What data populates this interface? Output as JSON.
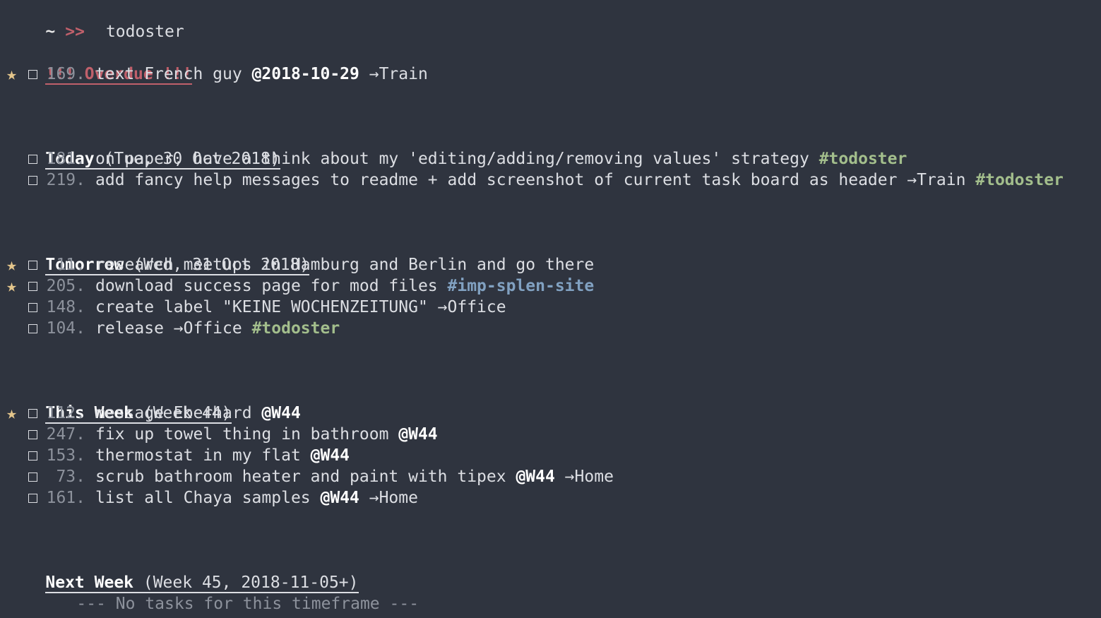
{
  "prompt": {
    "tilde": "~",
    "arrow": ">>",
    "command": "todoster"
  },
  "overdue": {
    "title": "!!! Overdue !!!",
    "tasks": [
      {
        "starred": true,
        "num": "169.",
        "text": "text French guy ",
        "date": "@2018-10-29",
        "ctx": " →Train",
        "tag": ""
      }
    ]
  },
  "today": {
    "name": "Today",
    "sub": " (Tue, 30 Oct 2018)",
    "tasks": [
      {
        "starred": false,
        "num": "181.",
        "text": "on paper, have a think about my 'editing/adding/removing values' strategy ",
        "tag": "#todoster"
      },
      {
        "starred": false,
        "num": "219.",
        "text": "add fancy help messages to readme + add screenshot of current task board as header ",
        "ctx": "→Train ",
        "tag": "#todoster"
      }
    ]
  },
  "tomorrow": {
    "name": "Tomorrow",
    "sub": " (Wed, 31 Oct 2018)",
    "tasks": [
      {
        "starred": true,
        "num": "11.",
        "text": "research meetups in Hamburg and Berlin and go there"
      },
      {
        "starred": true,
        "num": "205.",
        "text": "download success page for mod files ",
        "tag": "#imp-splen-site",
        "tag_color": "blue"
      },
      {
        "starred": false,
        "num": "148.",
        "text": "create label \"KEINE WOCHENZEITUNG\" ",
        "ctx": "→Office"
      },
      {
        "starred": false,
        "num": "104.",
        "text": "release ",
        "ctx": "→Office ",
        "tag": "#todoster"
      }
    ]
  },
  "this_week": {
    "name": "This Week",
    "sub": " (Week 44)",
    "tasks": [
      {
        "starred": true,
        "num": "112.",
        "text": "message Eberhard ",
        "date": "@W44"
      },
      {
        "starred": false,
        "num": "247.",
        "text": "fix up towel thing in bathroom ",
        "date": "@W44"
      },
      {
        "starred": false,
        "num": "153.",
        "text": "thermostat in my flat ",
        "date": "@W44"
      },
      {
        "starred": false,
        "num": "73.",
        "text": "scrub bathroom heater and paint with tipex ",
        "date": "@W44",
        "ctx": " →Home"
      },
      {
        "starred": false,
        "num": "161.",
        "text": "list all Chaya samples ",
        "date": "@W44",
        "ctx": " →Home"
      }
    ]
  },
  "next_week": {
    "name": "Next Week",
    "sub": " (Week 45, 2018-11-05+)",
    "empty_message": "--- No tasks for this timeframe ---"
  },
  "icons": {
    "star": "★"
  },
  "colors": {
    "background": "#2f343f",
    "overdue": "#c0606b",
    "star": "#e3c58b",
    "tag_green": "#a3be8c",
    "tag_blue": "#81a1c1"
  }
}
